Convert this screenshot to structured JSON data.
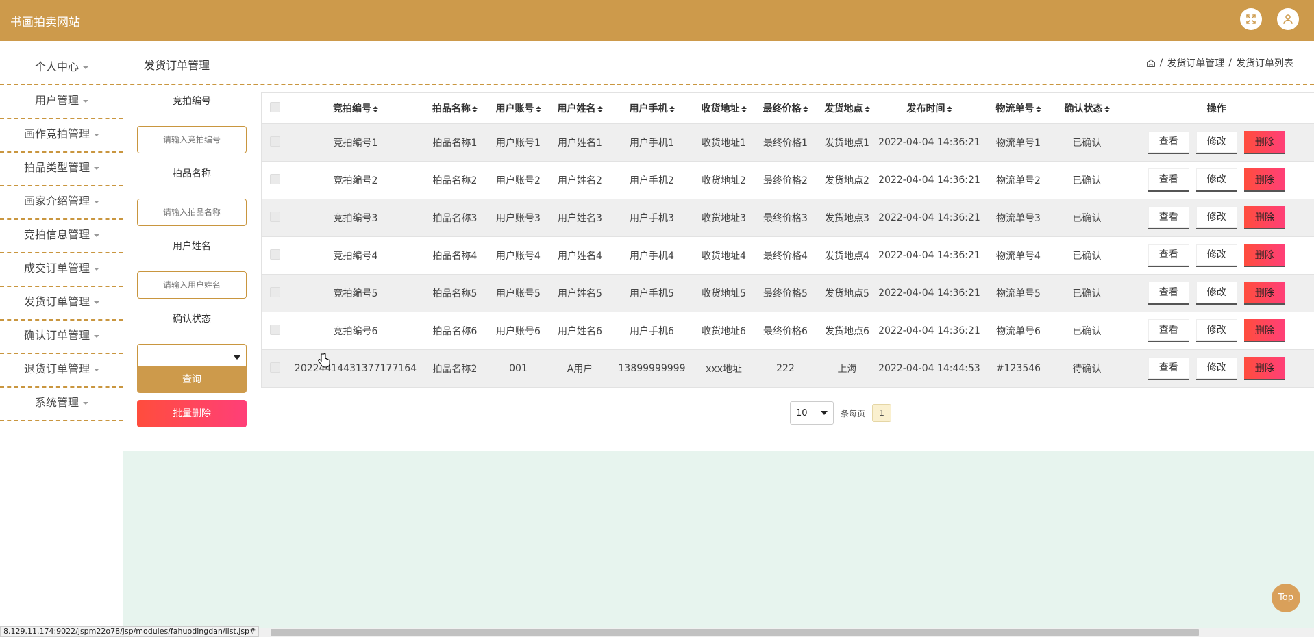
{
  "header": {
    "site_title": "书画拍卖网站"
  },
  "sidebar": {
    "items": [
      {
        "label": "个人中心"
      },
      {
        "label": "用户管理"
      },
      {
        "label": "画作竞拍管理"
      },
      {
        "label": "拍品类型管理"
      },
      {
        "label": "画家介绍管理"
      },
      {
        "label": "竞拍信息管理"
      },
      {
        "label": "成交订单管理"
      },
      {
        "label": "发货订单管理"
      },
      {
        "label": "确认订单管理"
      },
      {
        "label": "退货订单管理"
      },
      {
        "label": "系统管理"
      }
    ]
  },
  "page": {
    "title": "发货订单管理",
    "breadcrumb": [
      "发货订单管理",
      "发货订单列表"
    ],
    "separator": "/"
  },
  "search": {
    "field1_label": "竞拍编号",
    "field1_placeholder": "请输入竞拍编号",
    "field2_label": "拍品名称",
    "field2_placeholder": "请输入拍品名称",
    "field3_label": "用户姓名",
    "field3_placeholder": "请输入用户姓名",
    "field4_label": "确认状态",
    "query_label": "查询",
    "batch_delete_label": "批量删除"
  },
  "table": {
    "columns": [
      "竞拍编号",
      "拍品名称",
      "用户账号",
      "用户姓名",
      "用户手机",
      "收货地址",
      "最终价格",
      "发货地点",
      "发布时间",
      "物流单号",
      "确认状态",
      "操作"
    ],
    "view_label": "查看",
    "edit_label": "修改",
    "delete_label": "删除",
    "rows": [
      [
        "竞拍编号1",
        "拍品名称1",
        "用户账号1",
        "用户姓名1",
        "用户手机1",
        "收货地址1",
        "最终价格1",
        "发货地点1",
        "2022-04-04 14:36:21",
        "物流单号1",
        "已确认"
      ],
      [
        "竞拍编号2",
        "拍品名称2",
        "用户账号2",
        "用户姓名2",
        "用户手机2",
        "收货地址2",
        "最终价格2",
        "发货地点2",
        "2022-04-04 14:36:21",
        "物流单号2",
        "已确认"
      ],
      [
        "竞拍编号3",
        "拍品名称3",
        "用户账号3",
        "用户姓名3",
        "用户手机3",
        "收货地址3",
        "最终价格3",
        "发货地点3",
        "2022-04-04 14:36:21",
        "物流单号3",
        "已确认"
      ],
      [
        "竞拍编号4",
        "拍品名称4",
        "用户账号4",
        "用户姓名4",
        "用户手机4",
        "收货地址4",
        "最终价格4",
        "发货地点4",
        "2022-04-04 14:36:21",
        "物流单号4",
        "已确认"
      ],
      [
        "竞拍编号5",
        "拍品名称5",
        "用户账号5",
        "用户姓名5",
        "用户手机5",
        "收货地址5",
        "最终价格5",
        "发货地点5",
        "2022-04-04 14:36:21",
        "物流单号5",
        "已确认"
      ],
      [
        "竞拍编号6",
        "拍品名称6",
        "用户账号6",
        "用户姓名6",
        "用户手机6",
        "收货地址6",
        "最终价格6",
        "发货地点6",
        "2022-04-04 14:36:21",
        "物流单号6",
        "已确认"
      ],
      [
        "20224414431377177164",
        "拍品名称2",
        "001",
        "A用户",
        "13899999999",
        "xxx地址",
        "222",
        "上海",
        "2022-04-04 14:44:53",
        "#123546",
        "待确认"
      ]
    ]
  },
  "pager": {
    "page_size": "10",
    "per_page_label": "条每页",
    "current_page": "1"
  },
  "misc": {
    "top_label": "Top",
    "status_url": "8.129.11.174:9022/jspm22o78/jsp/modules/fahuodingdan/list.jsp#"
  },
  "colors": {
    "brand": "#cd9a4b",
    "danger": "#ff4d3d",
    "bottom_bg": "#e7f4ee"
  }
}
